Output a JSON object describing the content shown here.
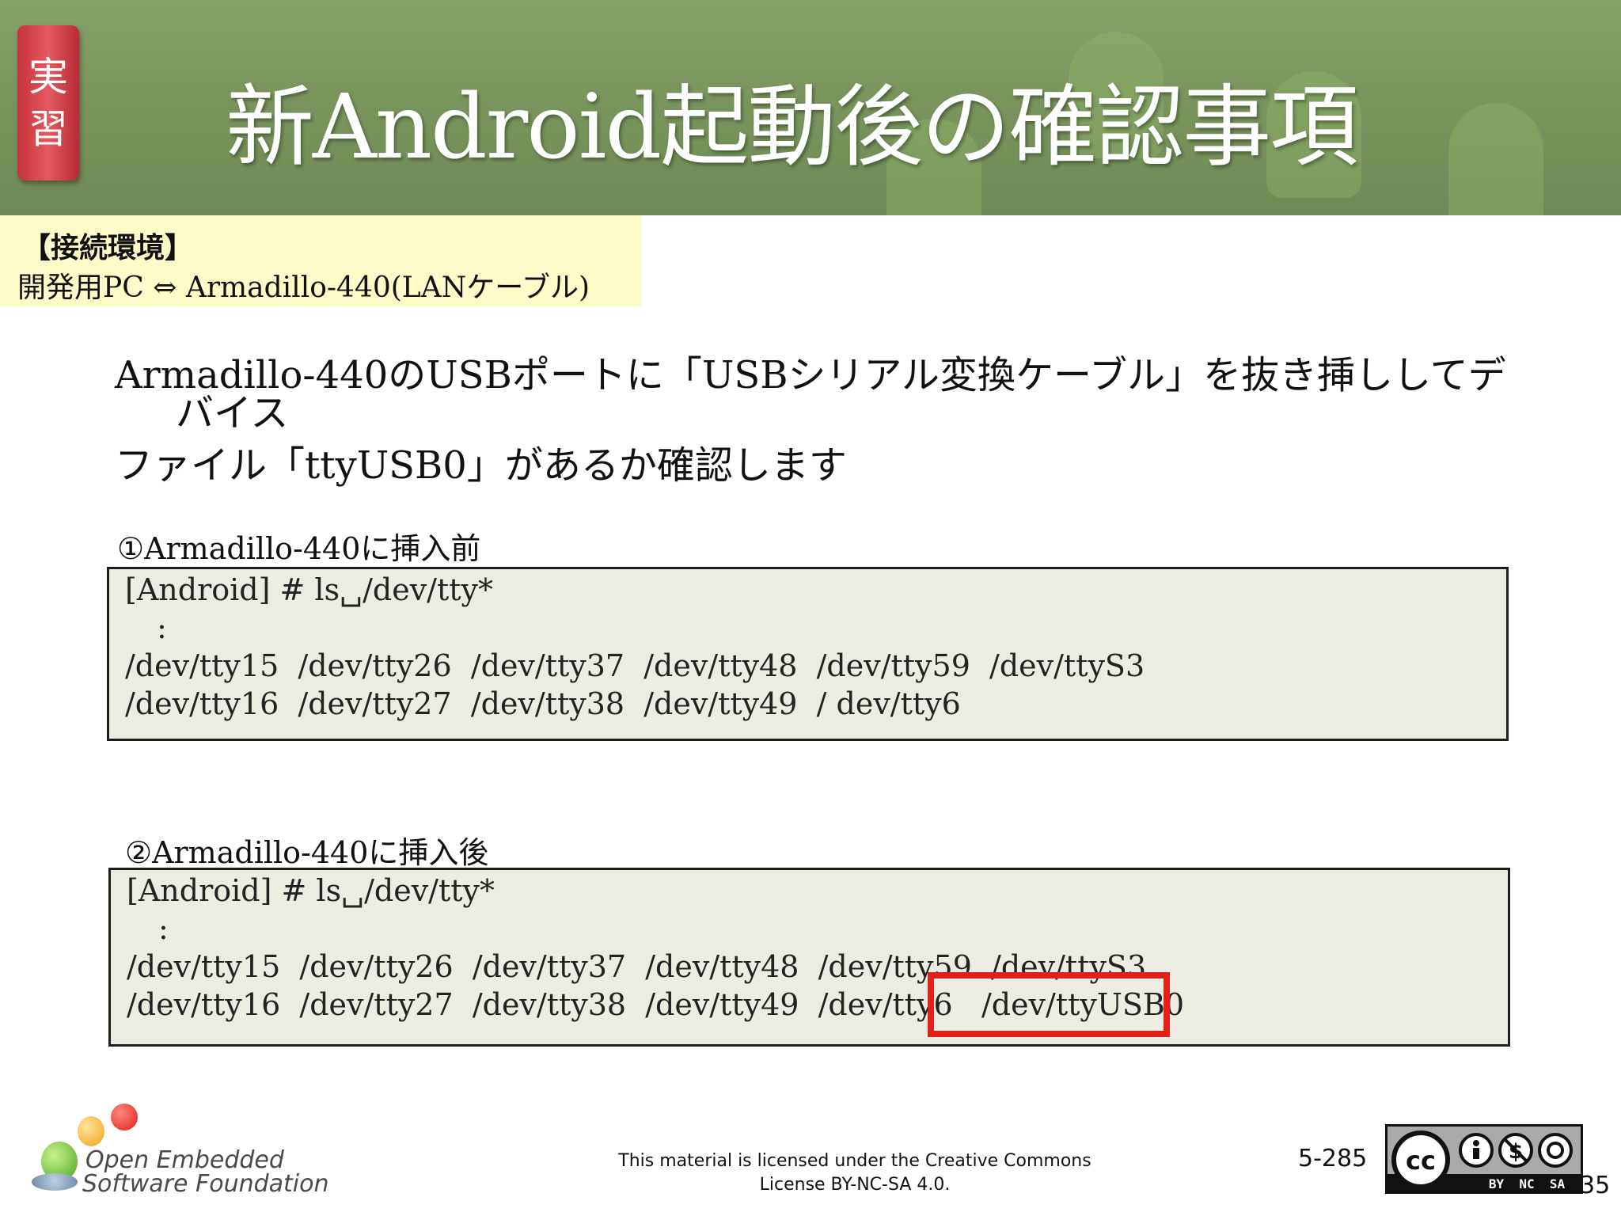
{
  "badge": {
    "line1": "実",
    "line2": "習"
  },
  "title": "新Android起動後の確認事項",
  "environment": {
    "heading": "【接続環境】",
    "connection": "開発用PC ⇔ Armadillo-440(LANケーブル)"
  },
  "instructions": {
    "line1": "Armadillo-440のUSBポートに「USBシリアル変換ケーブル」を抜き挿ししてデ",
    "line2": "バイス",
    "line3": "ファイル「ttyUSB0」があるか確認します"
  },
  "before": {
    "caption": "①Armadillo-440に挿入前",
    "command": "[Android] # ls␣/dev/tty*",
    "ellipsis": ":",
    "row1": "/dev/tty15  /dev/tty26  /dev/tty37  /dev/tty48  /dev/tty59  /dev/ttyS3",
    "row2": "/dev/tty16  /dev/tty27  /dev/tty38  /dev/tty49  / dev/tty6"
  },
  "after": {
    "caption": "②Armadillo-440に挿入後",
    "command": "[Android] # ls␣/dev/tty*",
    "ellipsis": ":",
    "row1": "/dev/tty15  /dev/tty26  /dev/tty37  /dev/tty48  /dev/tty59  /dev/ttyS3",
    "row2": "/dev/tty16  /dev/tty27  /dev/tty38  /dev/tty49  /dev/tty6   /dev/ttyUSB0"
  },
  "footer": {
    "org_line1": "Open Embedded",
    "org_line2": "Software Foundation",
    "license_line1": "This material is licensed under the Creative Commons",
    "license_line2": "License BY-NC-SA 4.0.",
    "page": "5-285",
    "page_suffix": "35",
    "cc_label": "cc",
    "cc_terms": "BY  NC  SA"
  },
  "colors": {
    "highlight": "#e4201b",
    "terminal_bg": "#edece3",
    "env_bg": "#fdfbc8",
    "badge": "#d8434a"
  }
}
